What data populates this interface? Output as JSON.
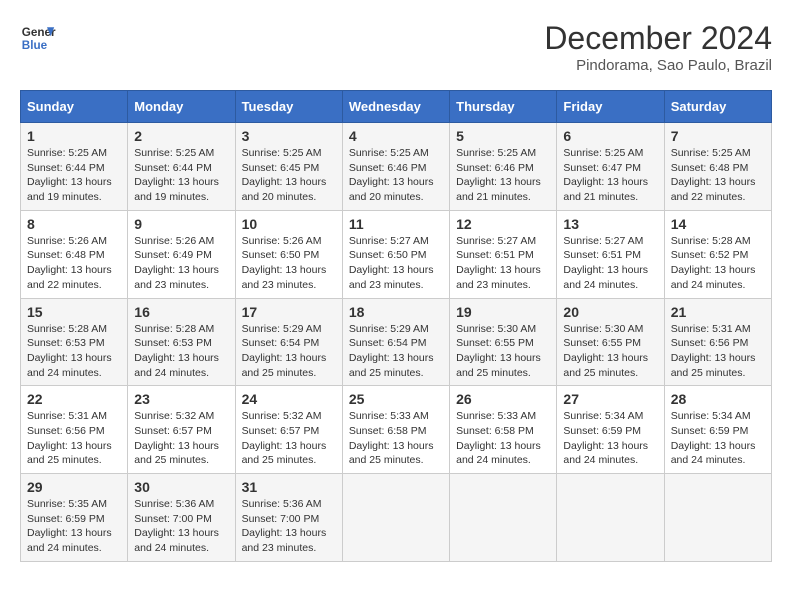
{
  "header": {
    "logo_line1": "General",
    "logo_line2": "Blue",
    "title": "December 2024",
    "subtitle": "Pindorama, Sao Paulo, Brazil"
  },
  "days_of_week": [
    "Sunday",
    "Monday",
    "Tuesday",
    "Wednesday",
    "Thursday",
    "Friday",
    "Saturday"
  ],
  "weeks": [
    [
      {
        "day": "1",
        "info": "Sunrise: 5:25 AM\nSunset: 6:44 PM\nDaylight: 13 hours\nand 19 minutes."
      },
      {
        "day": "2",
        "info": "Sunrise: 5:25 AM\nSunset: 6:44 PM\nDaylight: 13 hours\nand 19 minutes."
      },
      {
        "day": "3",
        "info": "Sunrise: 5:25 AM\nSunset: 6:45 PM\nDaylight: 13 hours\nand 20 minutes."
      },
      {
        "day": "4",
        "info": "Sunrise: 5:25 AM\nSunset: 6:46 PM\nDaylight: 13 hours\nand 20 minutes."
      },
      {
        "day": "5",
        "info": "Sunrise: 5:25 AM\nSunset: 6:46 PM\nDaylight: 13 hours\nand 21 minutes."
      },
      {
        "day": "6",
        "info": "Sunrise: 5:25 AM\nSunset: 6:47 PM\nDaylight: 13 hours\nand 21 minutes."
      },
      {
        "day": "7",
        "info": "Sunrise: 5:25 AM\nSunset: 6:48 PM\nDaylight: 13 hours\nand 22 minutes."
      }
    ],
    [
      {
        "day": "8",
        "info": "Sunrise: 5:26 AM\nSunset: 6:48 PM\nDaylight: 13 hours\nand 22 minutes."
      },
      {
        "day": "9",
        "info": "Sunrise: 5:26 AM\nSunset: 6:49 PM\nDaylight: 13 hours\nand 23 minutes."
      },
      {
        "day": "10",
        "info": "Sunrise: 5:26 AM\nSunset: 6:50 PM\nDaylight: 13 hours\nand 23 minutes."
      },
      {
        "day": "11",
        "info": "Sunrise: 5:27 AM\nSunset: 6:50 PM\nDaylight: 13 hours\nand 23 minutes."
      },
      {
        "day": "12",
        "info": "Sunrise: 5:27 AM\nSunset: 6:51 PM\nDaylight: 13 hours\nand 23 minutes."
      },
      {
        "day": "13",
        "info": "Sunrise: 5:27 AM\nSunset: 6:51 PM\nDaylight: 13 hours\nand 24 minutes."
      },
      {
        "day": "14",
        "info": "Sunrise: 5:28 AM\nSunset: 6:52 PM\nDaylight: 13 hours\nand 24 minutes."
      }
    ],
    [
      {
        "day": "15",
        "info": "Sunrise: 5:28 AM\nSunset: 6:53 PM\nDaylight: 13 hours\nand 24 minutes."
      },
      {
        "day": "16",
        "info": "Sunrise: 5:28 AM\nSunset: 6:53 PM\nDaylight: 13 hours\nand 24 minutes."
      },
      {
        "day": "17",
        "info": "Sunrise: 5:29 AM\nSunset: 6:54 PM\nDaylight: 13 hours\nand 25 minutes."
      },
      {
        "day": "18",
        "info": "Sunrise: 5:29 AM\nSunset: 6:54 PM\nDaylight: 13 hours\nand 25 minutes."
      },
      {
        "day": "19",
        "info": "Sunrise: 5:30 AM\nSunset: 6:55 PM\nDaylight: 13 hours\nand 25 minutes."
      },
      {
        "day": "20",
        "info": "Sunrise: 5:30 AM\nSunset: 6:55 PM\nDaylight: 13 hours\nand 25 minutes."
      },
      {
        "day": "21",
        "info": "Sunrise: 5:31 AM\nSunset: 6:56 PM\nDaylight: 13 hours\nand 25 minutes."
      }
    ],
    [
      {
        "day": "22",
        "info": "Sunrise: 5:31 AM\nSunset: 6:56 PM\nDaylight: 13 hours\nand 25 minutes."
      },
      {
        "day": "23",
        "info": "Sunrise: 5:32 AM\nSunset: 6:57 PM\nDaylight: 13 hours\nand 25 minutes."
      },
      {
        "day": "24",
        "info": "Sunrise: 5:32 AM\nSunset: 6:57 PM\nDaylight: 13 hours\nand 25 minutes."
      },
      {
        "day": "25",
        "info": "Sunrise: 5:33 AM\nSunset: 6:58 PM\nDaylight: 13 hours\nand 25 minutes."
      },
      {
        "day": "26",
        "info": "Sunrise: 5:33 AM\nSunset: 6:58 PM\nDaylight: 13 hours\nand 24 minutes."
      },
      {
        "day": "27",
        "info": "Sunrise: 5:34 AM\nSunset: 6:59 PM\nDaylight: 13 hours\nand 24 minutes."
      },
      {
        "day": "28",
        "info": "Sunrise: 5:34 AM\nSunset: 6:59 PM\nDaylight: 13 hours\nand 24 minutes."
      }
    ],
    [
      {
        "day": "29",
        "info": "Sunrise: 5:35 AM\nSunset: 6:59 PM\nDaylight: 13 hours\nand 24 minutes."
      },
      {
        "day": "30",
        "info": "Sunrise: 5:36 AM\nSunset: 7:00 PM\nDaylight: 13 hours\nand 24 minutes."
      },
      {
        "day": "31",
        "info": "Sunrise: 5:36 AM\nSunset: 7:00 PM\nDaylight: 13 hours\nand 23 minutes."
      },
      {
        "day": "",
        "info": ""
      },
      {
        "day": "",
        "info": ""
      },
      {
        "day": "",
        "info": ""
      },
      {
        "day": "",
        "info": ""
      }
    ]
  ]
}
